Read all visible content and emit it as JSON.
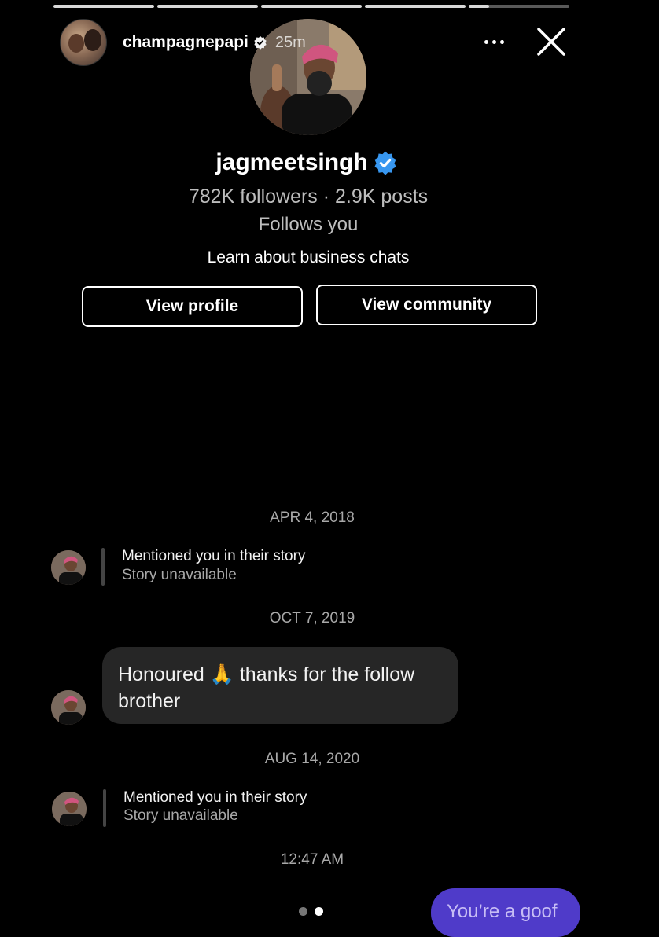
{
  "story": {
    "progress": [
      1,
      1,
      1,
      1,
      0.2
    ],
    "username": "champagnepapi",
    "time": "25m",
    "more_icon": "more-horizontal-icon",
    "close_icon": "close-icon"
  },
  "profile": {
    "username": "jagmeetsingh",
    "verified_color": "#3897f0",
    "stats": "782K followers · 2.9K posts",
    "follows_you": "Follows you",
    "learn": "Learn about business chats",
    "view_profile": "View profile",
    "view_community": "View community"
  },
  "chat": {
    "date1": "APR 4, 2018",
    "mention1_title": "Mentioned you in their story",
    "mention1_sub": "Story unavailable",
    "date2": "OCT 7, 2019",
    "message_part1": "Honoured",
    "message_emoji": "🙏",
    "message_part2": "thanks for the follow brother",
    "date3": "AUG 14, 2020",
    "mention2_title": "Mentioned you in their story",
    "mention2_sub": "Story unavailable",
    "time4": "12:47 AM",
    "outgoing": "You’re a goof",
    "outgoing_color": "#4f3bc9"
  },
  "pager": {
    "count": 2,
    "active": 2
  }
}
